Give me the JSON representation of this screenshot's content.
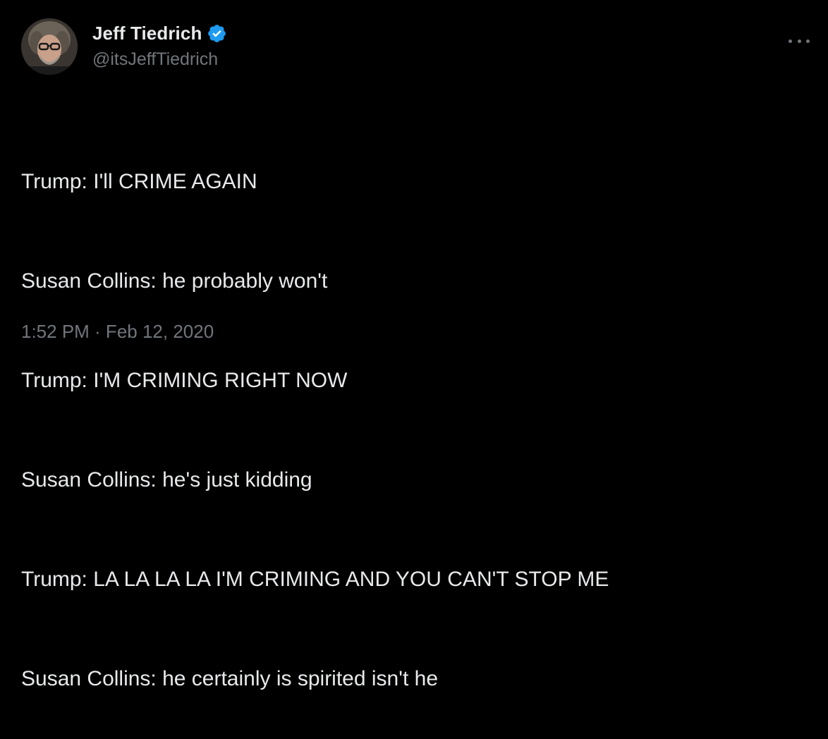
{
  "author": {
    "display_name": "Jeff Tiedrich",
    "handle": "@itsJeffTiedrich",
    "verified": true,
    "verified_color": "#1d9bf0"
  },
  "tweet": {
    "lines": [
      "Trump: I'll CRIME AGAIN",
      "Susan Collins: he probably won't",
      "Trump: I'M CRIMING RIGHT NOW",
      "Susan Collins: he's just kidding",
      "Trump: LA LA LA LA I'M CRIMING AND YOU CAN'T STOP ME",
      "Susan Collins: he certainly is spirited isn't he"
    ],
    "timestamp": "1:52 PM · Feb 12, 2020"
  },
  "icons": {
    "more": "more-horizontal-icon",
    "verified": "verified-badge-icon"
  },
  "colors": {
    "background": "#000000",
    "text": "#e7e9ea",
    "secondary": "#71767b"
  }
}
